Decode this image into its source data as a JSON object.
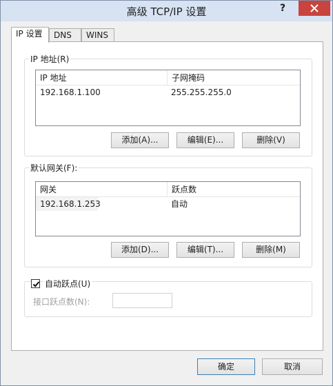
{
  "window": {
    "title": "高级 TCP/IP 设置",
    "help_glyph": "?",
    "close_label": "×"
  },
  "tabs": [
    {
      "label": "IP 设置",
      "active": true
    },
    {
      "label": "DNS",
      "active": false
    },
    {
      "label": "WINS",
      "active": false
    }
  ],
  "ip_group": {
    "label": "IP 地址(R)",
    "columns": [
      "IP 地址",
      "子网掩码"
    ],
    "rows": [
      {
        "ip": "192.168.1.100",
        "mask": "255.255.255.0"
      }
    ],
    "buttons": {
      "add": "添加(A)...",
      "edit": "编辑(E)...",
      "delete": "删除(V)"
    }
  },
  "gateway_group": {
    "label": "默认网关(F):",
    "columns": [
      "网关",
      "跃点数"
    ],
    "rows": [
      {
        "gateway": "192.168.1.253",
        "metric": "自动"
      }
    ],
    "buttons": {
      "add": "添加(D)...",
      "edit": "编辑(T)...",
      "delete": "删除(M)"
    }
  },
  "metric_group": {
    "auto_metric_label": "自动跃点(U)",
    "auto_metric_checked": true,
    "interface_metric_label": "接口跃点数(N):",
    "interface_metric_value": ""
  },
  "footer": {
    "ok": "确定",
    "cancel": "取消"
  }
}
